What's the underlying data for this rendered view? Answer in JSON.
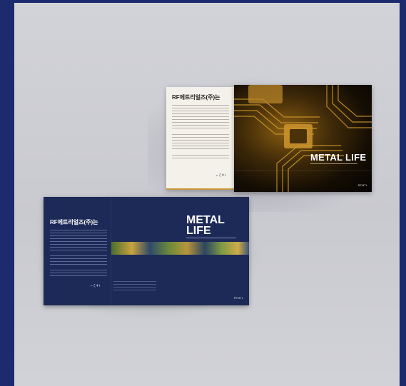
{
  "upper_brochure": {
    "left_heading": "RF에트리얼즈(주)는",
    "right_title": "METAL LIFE",
    "logo_mark": "⌐ ζ ǂ ɨ",
    "brand_mark": "RFMTL"
  },
  "lower_brochure": {
    "left_heading": "RF에트리얼즈(주)는",
    "title_line1": "METAL",
    "title_line2": "LIFE",
    "logo_mark": "⌐ ζ ǂ ɨ",
    "brand_mark": "RFMTL"
  },
  "colors": {
    "frame_background": "#1b2b6e",
    "wall": "#cfd0d5",
    "navy_brochure": "#1d2a57",
    "gold_accent": "#c79a3a"
  }
}
